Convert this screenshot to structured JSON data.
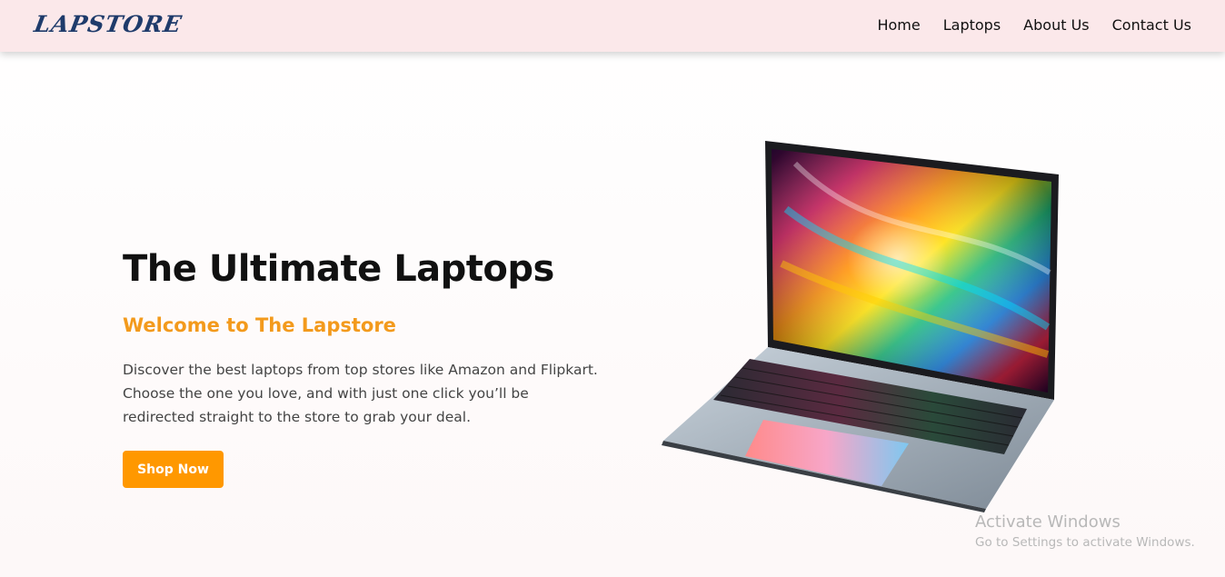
{
  "navbar": {
    "logo": "LAPSTORE",
    "links": [
      "Home",
      "Laptops",
      "About Us",
      "Contact Us"
    ]
  },
  "hero": {
    "title": "The Ultimate Laptops",
    "subtitle": "Welcome to The Lapstore",
    "description": "Discover the best laptops from top stores like Amazon and Flipkart. Choose the one you love, and with just one click you’ll be redirected straight to the store to grab your deal.",
    "button_label": "Shop Now",
    "image": "laptop-with-colorful-swirl-wallpaper"
  },
  "watermark": {
    "title": "Activate Windows",
    "subtitle": "Go to Settings to activate Windows."
  },
  "colors": {
    "navbar_bg": "#fbe8ea",
    "logo": "#1f3b6b",
    "accent": "#ff9800",
    "subtitle": "#f39a1c"
  }
}
